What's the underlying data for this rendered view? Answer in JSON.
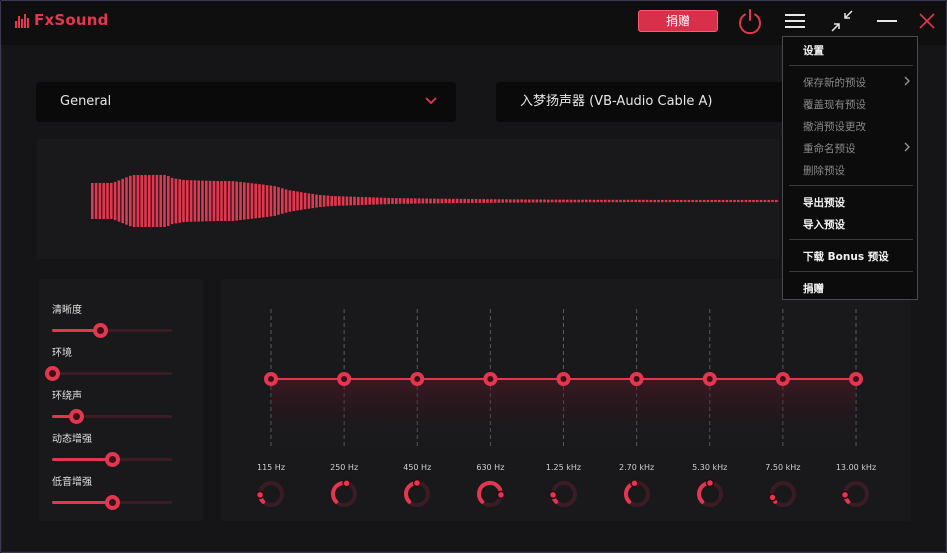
{
  "app": {
    "name": "FxSound"
  },
  "titlebar": {
    "donate_label": "捐赠",
    "icons": [
      "power-icon",
      "hamburger-menu-icon",
      "minimize-window-icon",
      "minus-icon",
      "close-icon"
    ]
  },
  "preset_select": {
    "value": "General"
  },
  "device_select": {
    "value": "入梦扬声器 (VB-Audio Cable A)"
  },
  "effects": [
    {
      "label": "清晰度",
      "value": 0.4
    },
    {
      "label": "环境",
      "value": 0.0
    },
    {
      "label": "环绕声",
      "value": 0.2
    },
    {
      "label": "动态增强",
      "value": 0.5
    },
    {
      "label": "低音增强",
      "value": 0.5
    }
  ],
  "eq": {
    "bands": [
      "115 Hz",
      "250 Hz",
      "450 Hz",
      "630 Hz",
      "1.25 kHz",
      "2.70 kHz",
      "5.30 kHz",
      "7.50 kHz",
      "13.00 kHz"
    ],
    "gains": [
      0,
      0,
      0,
      0,
      0,
      0,
      0,
      0,
      0
    ],
    "dial_positions": [
      0.15,
      0.55,
      0.5,
      0.85,
      0.15,
      0.45,
      0.5,
      0.1,
      0.15
    ]
  },
  "menu": {
    "items": [
      {
        "label": "设置",
        "enabled": true
      },
      {
        "label": "保存新的预设",
        "enabled": false,
        "submenu": true
      },
      {
        "label": "覆盖现有预设",
        "enabled": false
      },
      {
        "label": "撤消预设更改",
        "enabled": false
      },
      {
        "label": "重命名预设",
        "enabled": false,
        "submenu": true
      },
      {
        "label": "删除预设",
        "enabled": false
      },
      {
        "label": "导出预设",
        "enabled": true
      },
      {
        "label": "导入预设",
        "enabled": true
      },
      {
        "label": "下载 Bonus 预设",
        "enabled": true
      },
      {
        "label": "捐赠",
        "enabled": true
      }
    ]
  },
  "colors": {
    "accent": "#e5364f",
    "background": "#151517",
    "panel": "#19191b"
  }
}
